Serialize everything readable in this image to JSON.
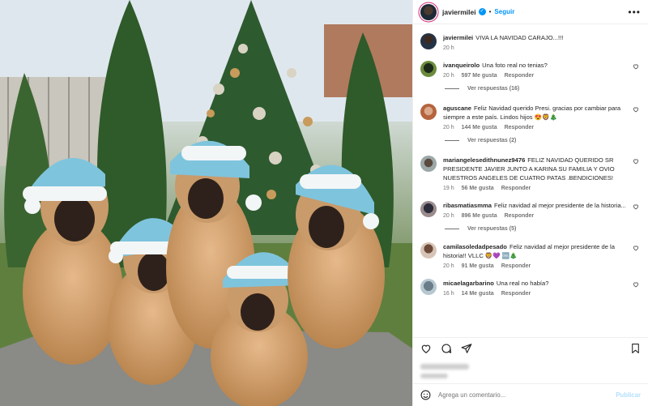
{
  "post": {
    "author": "javiermilei",
    "follow_label": "Seguir",
    "separator": "•",
    "caption": "VIVA LA NAVIDAD CARAJO...!!!",
    "caption_time": "20 h"
  },
  "comments": [
    {
      "user": "ivanqueirolo",
      "text": "Una foto real no tenias?",
      "time": "20 h",
      "likes": "597 Me gusta",
      "reply": "Responder",
      "replies": "Ver respuestas (16)"
    },
    {
      "user": "aguscane",
      "text": "Feliz Navidad querido Presi. gracias por cambiar para siempre a este país. Lindos hijos 😍🦁🎄",
      "time": "20 h",
      "likes": "144 Me gusta",
      "reply": "Responder",
      "replies": "Ver respuestas (2)"
    },
    {
      "user": "mariangelesedithnunez9476",
      "text": "FELIZ NAVIDAD QUERIDO SR PRESIDENTE JAVIER JUNTO A KARINA SU FAMILIA Y OVIO NUESTROS ANGELES DE CUATRO PATAS .BENDICIONES!",
      "time": "19 h",
      "likes": "56 Me gusta",
      "reply": "Responder",
      "replies": ""
    },
    {
      "user": "ribasmatiasmma",
      "text": "Feliz navidad al mejor presidente de la historia...",
      "time": "20 h",
      "likes": "896 Me gusta",
      "reply": "Responder",
      "replies": "Ver respuestas (5)"
    },
    {
      "user": "camilasoledadpesado",
      "text": "Feliz navidad al mejor presidente de la historia!! VLLC 🦁💜 🆒🎄",
      "time": "20 h",
      "likes": "91 Me gusta",
      "reply": "Responder",
      "replies": ""
    },
    {
      "user": "micaelagarbarino",
      "text": "Una real no había?",
      "time": "16 h",
      "likes": "14 Me gusta",
      "reply": "Responder",
      "replies": ""
    }
  ],
  "add_comment": {
    "placeholder": "Agrega un comentario...",
    "publish": "Publicar"
  },
  "icons": [
    "more-icon",
    "verified-icon",
    "heart-icon",
    "comment-icon",
    "share-icon",
    "bookmark-icon",
    "emoji-icon"
  ]
}
